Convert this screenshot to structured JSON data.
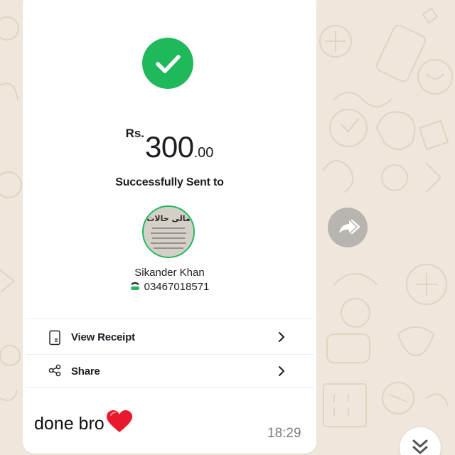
{
  "receipt": {
    "currency": "Rs.",
    "amount_int": "300",
    "amount_dec": ".00",
    "status": "Successfully Sent to",
    "recipient_name": "Sikander Khan",
    "recipient_phone": "03467018571",
    "avatar_title": "مالی حالات",
    "actions": [
      {
        "label": "View Receipt",
        "icon": "receipt-icon"
      },
      {
        "label": "Share",
        "icon": "share-icon"
      }
    ]
  },
  "message": {
    "text": "done bro",
    "emoji": "heart",
    "time": "18:29"
  },
  "colors": {
    "success_green": "#1fb85a",
    "wallpaper": "#efe7dc",
    "bubble": "#ffffff",
    "text_dark": "#1d1d24",
    "time_gray": "#7d7d7d"
  },
  "icons": [
    "check-icon",
    "wallet-icon",
    "receipt-icon",
    "share-icon",
    "chevron-right-icon",
    "forward-icon",
    "heart-icon",
    "double-chevron-down-icon"
  ]
}
